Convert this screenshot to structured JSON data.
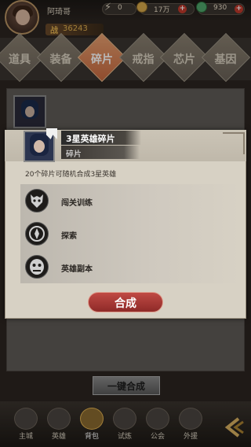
{
  "header": {
    "player_name": "阿琦哥",
    "energy": "0",
    "gold": "17万",
    "gems": "930",
    "power_label": "战",
    "power_value": "36243"
  },
  "tabs": [
    {
      "label": "道具",
      "active": false
    },
    {
      "label": "装备",
      "active": false
    },
    {
      "label": "碎片",
      "active": true
    },
    {
      "label": "戒指",
      "active": false
    },
    {
      "label": "芯片",
      "active": false
    },
    {
      "label": "基因",
      "active": false
    }
  ],
  "modal": {
    "item_title": "3星英雄碎片",
    "item_type": "碎片",
    "description": "20个碎片可随机合成3星英雄",
    "sources": [
      {
        "label": "闯关训练",
        "icon": "wolf-head-icon"
      },
      {
        "label": "探索",
        "icon": "compass-icon"
      },
      {
        "label": "英雄副本",
        "icon": "monster-face-icon"
      }
    ],
    "compose_label": "合成"
  },
  "one_click_label": "一键合成",
  "bottom_nav": [
    {
      "label": "主城",
      "active": false
    },
    {
      "label": "英雄",
      "active": false
    },
    {
      "label": "背包",
      "active": true
    },
    {
      "label": "试炼",
      "active": false
    },
    {
      "label": "公会",
      "active": false
    },
    {
      "label": "外援",
      "active": false
    }
  ],
  "colors": {
    "accent_red": "#a83a36",
    "active_tab": "#d8855a",
    "modal_bg": "#d7d1c4"
  }
}
